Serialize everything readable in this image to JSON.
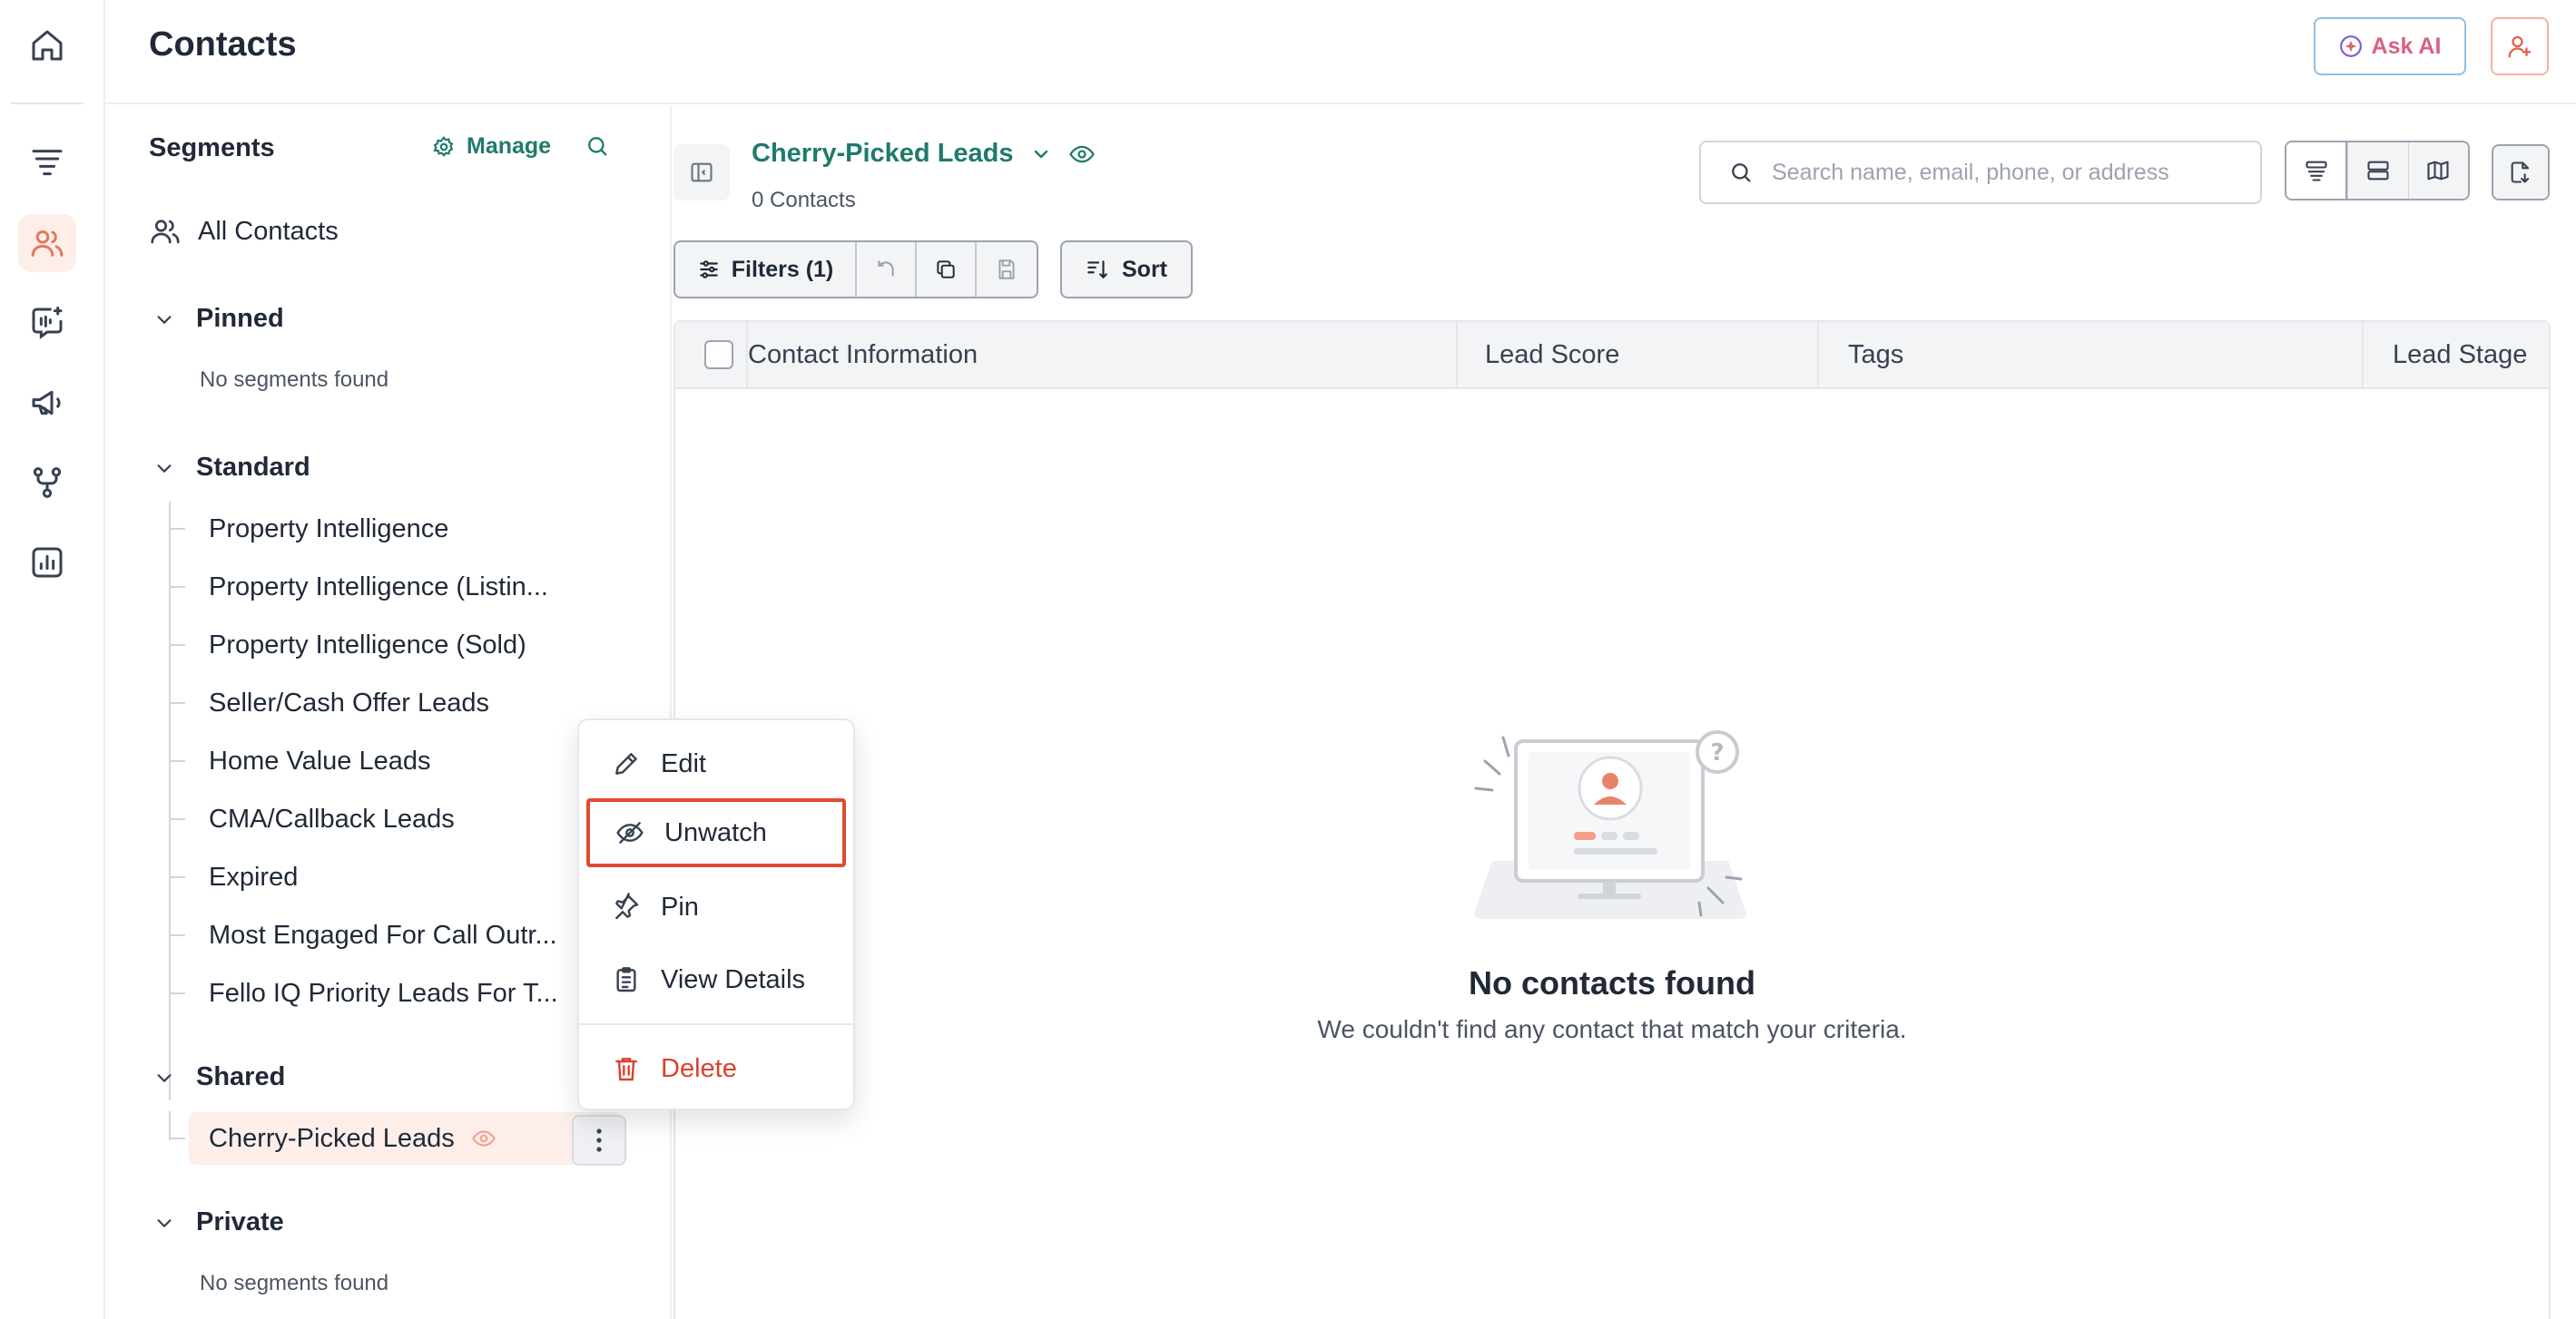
{
  "header": {
    "title": "Contacts",
    "ask_ai_label": "Ask AI"
  },
  "segments": {
    "title": "Segments",
    "manage_label": "Manage",
    "all_contacts_label": "All Contacts",
    "groups": {
      "pinned": {
        "label": "Pinned",
        "empty": "No segments found"
      },
      "standard": {
        "label": "Standard",
        "items": [
          "Property Intelligence",
          "Property Intelligence (Listin...",
          "Property Intelligence (Sold)",
          "Seller/Cash Offer Leads",
          "Home Value Leads",
          "CMA/Callback Leads",
          "Expired",
          "Most Engaged For Call Outr...",
          "Fello IQ Priority Leads For T..."
        ]
      },
      "shared": {
        "label": "Shared",
        "items": [
          "Cherry-Picked Leads"
        ]
      },
      "private": {
        "label": "Private",
        "empty": "No segments found"
      }
    }
  },
  "main": {
    "segment_name": "Cherry-Picked Leads",
    "contact_count": "0 Contacts",
    "search_placeholder": "Search name, email, phone, or address",
    "filters_label": "Filters (1)",
    "sort_label": "Sort",
    "columns": [
      "Contact Information",
      "Lead Score",
      "Tags",
      "Lead Stage"
    ],
    "empty_title": "No contacts found",
    "empty_subtitle": "We couldn't find any contact that match your criteria."
  },
  "context_menu": {
    "items": [
      "Edit",
      "Unwatch",
      "Pin",
      "View Details",
      "Delete"
    ],
    "highlighted": "Unwatch"
  },
  "colors": {
    "accent_teal": "#1f7a6d",
    "accent_coral": "#e07a5f",
    "danger": "#d9412e",
    "highlight_border": "#e04a33"
  }
}
